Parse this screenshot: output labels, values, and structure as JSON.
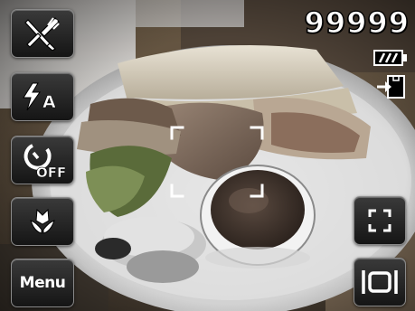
{
  "viewfinder": {
    "shots_remaining": "99999"
  },
  "left_menu": {
    "items": [
      {
        "name": "scene-mode",
        "icon": "cutlery-food-icon"
      },
      {
        "name": "flash-mode",
        "icon": "flash-auto-icon",
        "text": "A"
      },
      {
        "name": "self-timer",
        "icon": "self-timer-off-icon",
        "text": "OFF"
      },
      {
        "name": "macro-mode",
        "icon": "macro-flower-icon"
      },
      {
        "name": "menu",
        "label": "Menu"
      }
    ]
  },
  "status": {
    "battery_icon": "battery-full-icon",
    "storage_icon": "internal-memory-icon"
  },
  "right_controls": {
    "focus_frame_icon": "focus-frame-icon",
    "display_icon": "display-mode-icon"
  }
}
